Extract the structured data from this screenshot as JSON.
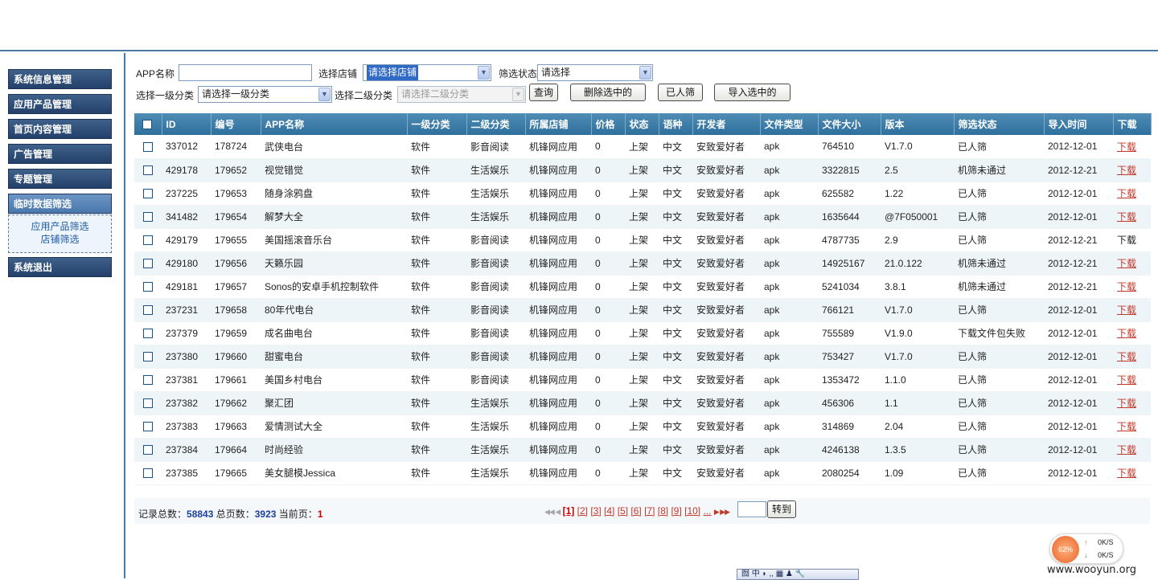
{
  "nav": {
    "items": [
      "系统信息管理",
      "应用产品管理",
      "首页内容管理",
      "广告管理",
      "专题管理",
      "临时数据筛选",
      "系统退出"
    ],
    "sub_items": [
      "应用产品筛选",
      "店铺筛选"
    ]
  },
  "filter": {
    "app_name_label": "APP名称",
    "app_name_value": "",
    "store_label": "选择店铺",
    "store_value": "请选择店铺",
    "status_label": "筛选状态",
    "status_value": "请选择",
    "cat1_label": "选择一级分类",
    "cat1_value": "请选择一级分类",
    "cat2_label": "选择二级分类",
    "cat2_value": "请选择二级分类",
    "buttons": {
      "query": "查询",
      "delete": "删除选中的",
      "manual": "已人筛",
      "import": "导入选中的"
    }
  },
  "table": {
    "headers": [
      "ID",
      "编号",
      "APP名称",
      "一级分类",
      "二级分类",
      "所属店铺",
      "价格",
      "状态",
      "语种",
      "开发者",
      "文件类型",
      "文件大小",
      "版本",
      "筛选状态",
      "导入时间",
      "下载"
    ],
    "rows": [
      [
        "337012",
        "178724",
        "武侠电台",
        "软件",
        "影音阅读",
        "机锋网应用",
        "0",
        "上架",
        "中文",
        "安致爱好者",
        "apk",
        "764510",
        "V1.7.0",
        "已人筛",
        "2012-12-01",
        "下载"
      ],
      [
        "429178",
        "179652",
        "视觉错觉",
        "软件",
        "生活娱乐",
        "机锋网应用",
        "0",
        "上架",
        "中文",
        "安致爱好者",
        "apk",
        "3322815",
        "2.5",
        "机筛未通过",
        "2012-12-21",
        "下载"
      ],
      [
        "237225",
        "179653",
        "随身涂鸦盘",
        "软件",
        "生活娱乐",
        "机锋网应用",
        "0",
        "上架",
        "中文",
        "安致爱好者",
        "apk",
        "625582",
        "1.22",
        "已人筛",
        "2012-12-01",
        "下载"
      ],
      [
        "341482",
        "179654",
        "解梦大全",
        "软件",
        "生活娱乐",
        "机锋网应用",
        "0",
        "上架",
        "中文",
        "安致爱好者",
        "apk",
        "1635644",
        "@7F050001",
        "已人筛",
        "2012-12-01",
        "下载"
      ],
      [
        "429179",
        "179655",
        "美国摇滚音乐台",
        "软件",
        "影音阅读",
        "机锋网应用",
        "0",
        "上架",
        "中文",
        "安致爱好者",
        "apk",
        "4787735",
        "2.9",
        "已人筛",
        "2012-12-21",
        "下载"
      ],
      [
        "429180",
        "179656",
        "天籁乐园",
        "软件",
        "影音阅读",
        "机锋网应用",
        "0",
        "上架",
        "中文",
        "安致爱好者",
        "apk",
        "14925167",
        "21.0.122",
        "机筛未通过",
        "2012-12-21",
        "下载"
      ],
      [
        "429181",
        "179657",
        "Sonos的安卓手机控制软件",
        "软件",
        "影音阅读",
        "机锋网应用",
        "0",
        "上架",
        "中文",
        "安致爱好者",
        "apk",
        "5241034",
        "3.8.1",
        "机筛未通过",
        "2012-12-21",
        "下载"
      ],
      [
        "237231",
        "179658",
        "80年代电台",
        "软件",
        "影音阅读",
        "机锋网应用",
        "0",
        "上架",
        "中文",
        "安致爱好者",
        "apk",
        "766121",
        "V1.7.0",
        "已人筛",
        "2012-12-01",
        "下载"
      ],
      [
        "237379",
        "179659",
        "成名曲电台",
        "软件",
        "影音阅读",
        "机锋网应用",
        "0",
        "上架",
        "中文",
        "安致爱好者",
        "apk",
        "755589",
        "V1.9.0",
        "下载文件包失败",
        "2012-12-01",
        "下载"
      ],
      [
        "237380",
        "179660",
        "甜蜜电台",
        "软件",
        "影音阅读",
        "机锋网应用",
        "0",
        "上架",
        "中文",
        "安致爱好者",
        "apk",
        "753427",
        "V1.7.0",
        "已人筛",
        "2012-12-01",
        "下载"
      ],
      [
        "237381",
        "179661",
        "美国乡村电台",
        "软件",
        "影音阅读",
        "机锋网应用",
        "0",
        "上架",
        "中文",
        "安致爱好者",
        "apk",
        "1353472",
        "1.1.0",
        "已人筛",
        "2012-12-01",
        "下载"
      ],
      [
        "237382",
        "179662",
        "聚汇团",
        "软件",
        "生活娱乐",
        "机锋网应用",
        "0",
        "上架",
        "中文",
        "安致爱好者",
        "apk",
        "456306",
        "1.1",
        "已人筛",
        "2012-12-01",
        "下载"
      ],
      [
        "237383",
        "179663",
        "爱情测试大全",
        "软件",
        "生活娱乐",
        "机锋网应用",
        "0",
        "上架",
        "中文",
        "安致爱好者",
        "apk",
        "314869",
        "2.04",
        "已人筛",
        "2012-12-01",
        "下载"
      ],
      [
        "237384",
        "179664",
        "时尚经验",
        "软件",
        "生活娱乐",
        "机锋网应用",
        "0",
        "上架",
        "中文",
        "安致爱好者",
        "apk",
        "4246138",
        "1.3.5",
        "已人筛",
        "2012-12-01",
        "下载"
      ],
      [
        "237385",
        "179665",
        "美女腿模Jessica",
        "软件",
        "生活娱乐",
        "机锋网应用",
        "0",
        "上架",
        "中文",
        "安致爱好者",
        "apk",
        "2080254",
        "1.09",
        "已人筛",
        "2012-12-01",
        "下载"
      ]
    ],
    "non_link_download_row": 4
  },
  "pager": {
    "total_label": "记录总数：",
    "total": "58843",
    "pages_label": "总页数：",
    "pages": "3923",
    "current_label": "当前页：",
    "current": "1",
    "page_links": [
      "[1]",
      "[2]",
      "[3]",
      "[4]",
      "[5]",
      "[6]",
      "[7]",
      "[8]",
      "[9]",
      "[10]",
      "..."
    ],
    "first_prev": "◀◀ ◀",
    "next_last": "▶ ▶▶",
    "goto_button": "转到",
    "goto_value": ""
  },
  "system": {
    "cpu_percent": "62%",
    "upload_speed": "0K/S",
    "download_speed": "0K/S",
    "ime_text": "囫 中 ◗ ,, ▦ ♟ 🔧",
    "watermark": "www.wooyun.org"
  },
  "colors": {
    "nav_bg": "#2d4b74",
    "header_bg": "#3a7ba8",
    "link_red": "#c0392b",
    "row_alt": "#eef5f9"
  }
}
